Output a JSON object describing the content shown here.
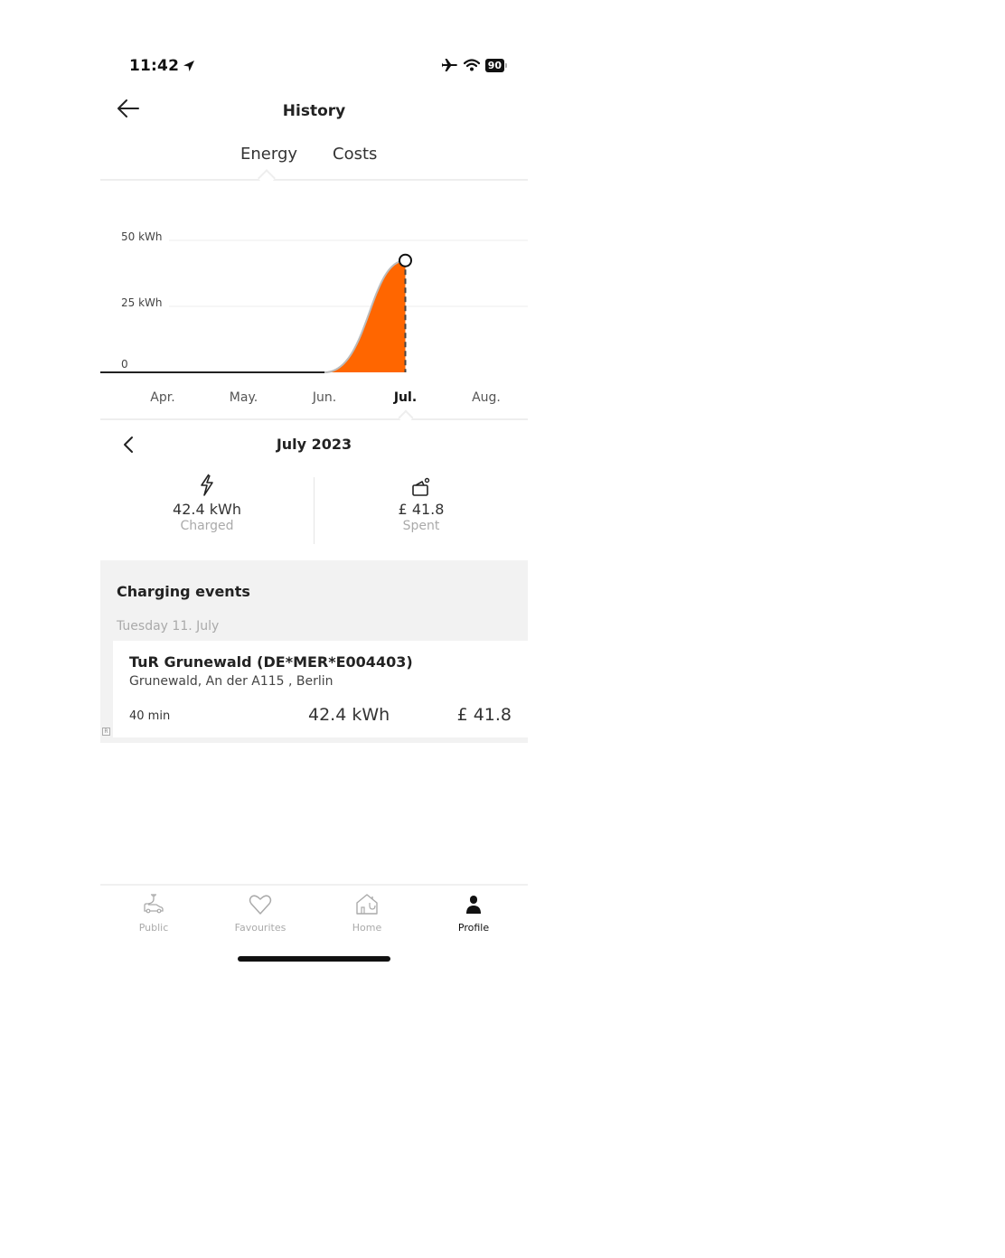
{
  "status_bar": {
    "time": "11:42",
    "location_icon": "location-arrow-icon",
    "airplane_icon": "airplane-icon",
    "wifi_icon": "wifi-icon",
    "battery_level": "90"
  },
  "header": {
    "back_icon": "arrow-left-icon",
    "title": "History"
  },
  "tabs": [
    {
      "label": "Energy",
      "active": true
    },
    {
      "label": "Costs",
      "active": false
    }
  ],
  "chart_data": {
    "type": "area",
    "title": "",
    "xlabel": "",
    "ylabel": "Energy (kWh)",
    "categories": [
      "Apr.",
      "May.",
      "Jun.",
      "Jul.",
      "Aug."
    ],
    "selected_category": "Jul.",
    "series": [
      {
        "name": "Energy",
        "values": [
          0,
          0,
          0,
          42.4,
          null
        ]
      }
    ],
    "y_ticks": [
      {
        "value": 0,
        "label": "0"
      },
      {
        "value": 25,
        "label": "25 kWh"
      },
      {
        "value": 50,
        "label": "50 kWh"
      }
    ],
    "ylim": [
      0,
      50
    ],
    "grid": true,
    "fill_color": "#ff6600",
    "legend": "none"
  },
  "period": {
    "prev_icon": "chevron-left-icon",
    "title": "July 2023"
  },
  "summary": {
    "charged": {
      "icon": "lightning-icon",
      "value": "42.4 kWh",
      "label": "Charged"
    },
    "spent": {
      "icon": "wallet-icon",
      "value": "£ 41.8",
      "label": "Spent"
    }
  },
  "events": {
    "title": "Charging events",
    "groups": [
      {
        "date": "Tuesday 11. July",
        "items": [
          {
            "name": "TuR Grunewald (DE*MER*E004403)",
            "address": "Grunewald, An der A115 , Berlin",
            "duration": "40 min",
            "energy": "42.4 kWh",
            "cost": "£ 41.8",
            "badge": "R"
          }
        ]
      }
    ]
  },
  "bottom_nav": [
    {
      "label": "Public",
      "icon": "car-charging-icon",
      "active": false
    },
    {
      "label": "Favourites",
      "icon": "heart-icon",
      "active": false
    },
    {
      "label": "Home",
      "icon": "home-charger-icon",
      "active": false
    },
    {
      "label": "Profile",
      "icon": "person-icon",
      "active": true
    }
  ]
}
